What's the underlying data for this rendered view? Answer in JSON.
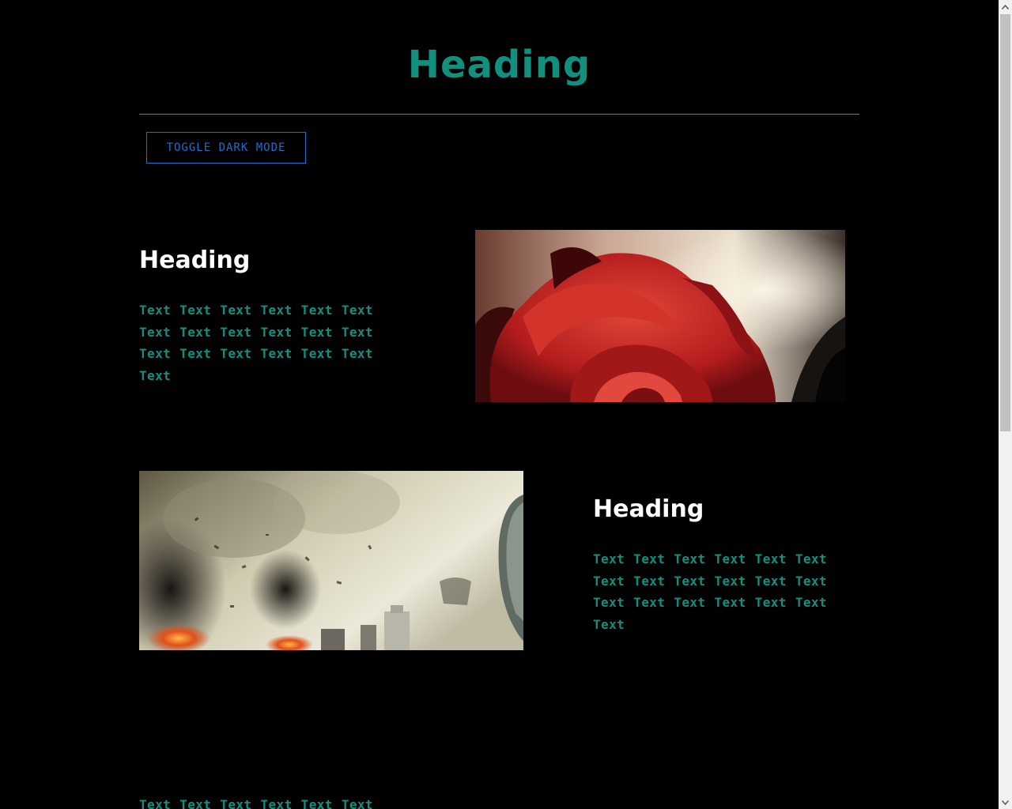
{
  "header": {
    "title": "Heading",
    "toggle_label": "TOGGLE DARK MODE"
  },
  "sections": [
    {
      "heading": "Heading",
      "text": "Text Text Text Text Text Text Text Text Text Text Text Text Text Text Text Text Text Text Text",
      "image": "rose-image"
    },
    {
      "heading": "Heading",
      "text": "Text Text Text Text Text Text Text Text Text Text Text Text Text Text Text Text Text Text Text",
      "image": "war-scene-image"
    },
    {
      "text": "Text Text Text Text Text Text"
    }
  ],
  "colors": {
    "background": "#000000",
    "accent": "#12907f",
    "button": "#1e6fce",
    "heading": "#ffffff"
  }
}
